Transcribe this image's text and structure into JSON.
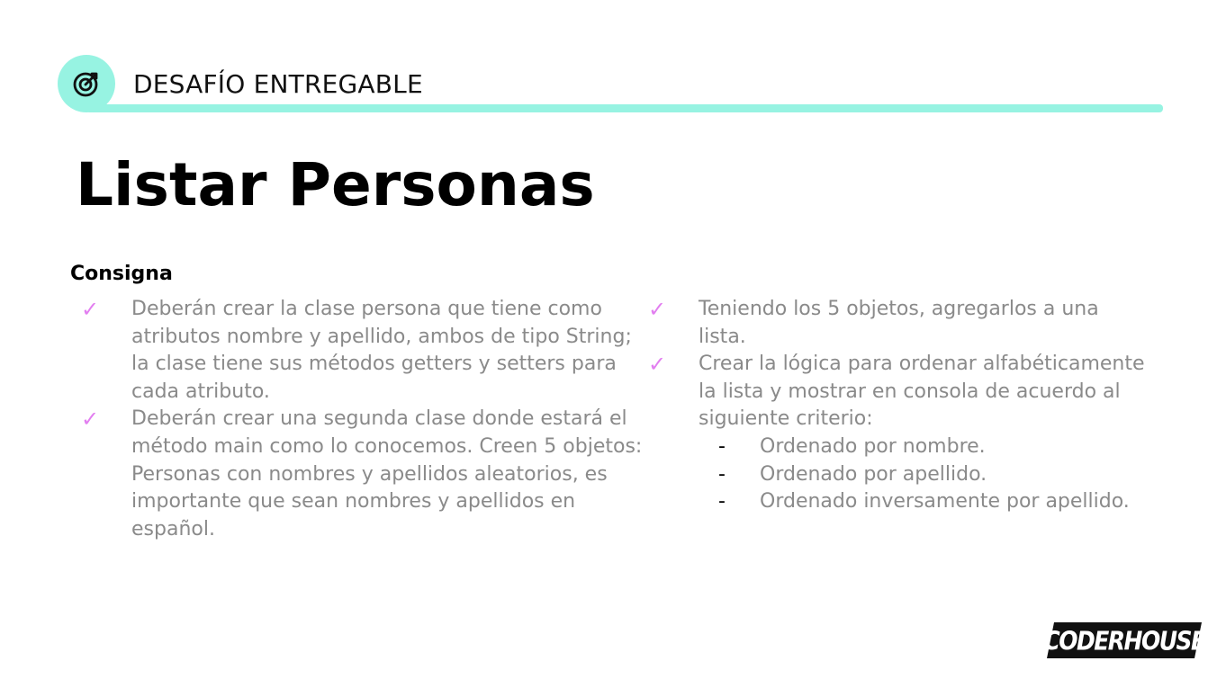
{
  "header": {
    "label": "DESAFÍO ENTREGABLE",
    "icon": "target-icon",
    "accent_color": "#97f3e2"
  },
  "title": "Listar Personas",
  "section": {
    "heading": "Consigna"
  },
  "left_items": [
    {
      "text": "Deberán crear la clase persona que tiene como atributos nombre y apellido, ambos de tipo String; la clase tiene sus métodos getters y setters para cada atributo."
    },
    {
      "text": "Deberán crear una segunda clase donde estará el método main como lo conocemos. Creen 5 objetos: Personas con nombres y apellidos aleatorios, es importante que sean nombres y apellidos en español."
    }
  ],
  "right_items": [
    {
      "text": "Teniendo los 5 objetos, agregarlos a una lista."
    },
    {
      "text": "Crear la lógica para ordenar alfabéticamente la lista y mostrar en consola de acuerdo al siguiente criterio:"
    }
  ],
  "sub_items": [
    "Ordenado por nombre.",
    "Ordenado por apellido.",
    "Ordenado inversamente por apellido."
  ],
  "bullets": {
    "check_symbol": "✓",
    "check_color": "#e27ff0",
    "dash_symbol": "-"
  },
  "logo": {
    "text": "CODERHOUSE"
  }
}
